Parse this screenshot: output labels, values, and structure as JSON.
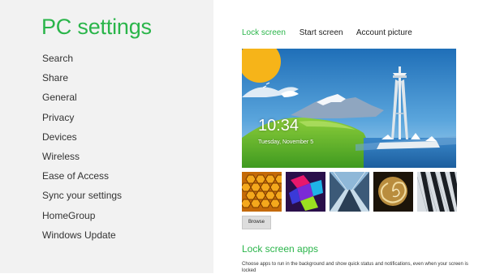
{
  "app_title": "PC settings",
  "nav": {
    "items": [
      "Search",
      "Share",
      "General",
      "Privacy",
      "Devices",
      "Wireless",
      "Ease of Access",
      "Sync your settings",
      "HomeGroup",
      "Windows Update"
    ]
  },
  "tabs": [
    "Lock screen",
    "Start screen",
    "Account picture"
  ],
  "active_tab": 0,
  "lock_preview": {
    "time": "10:34",
    "date": "Tuesday, November 5"
  },
  "browse_label": "Browse",
  "section": {
    "title": "Lock screen apps",
    "description": "Choose apps to run in the background and show quick status and notifications, even when your screen is locked"
  },
  "colors": {
    "accent": "#2ab54a",
    "left_panel_bg": "#f2f2f2"
  }
}
